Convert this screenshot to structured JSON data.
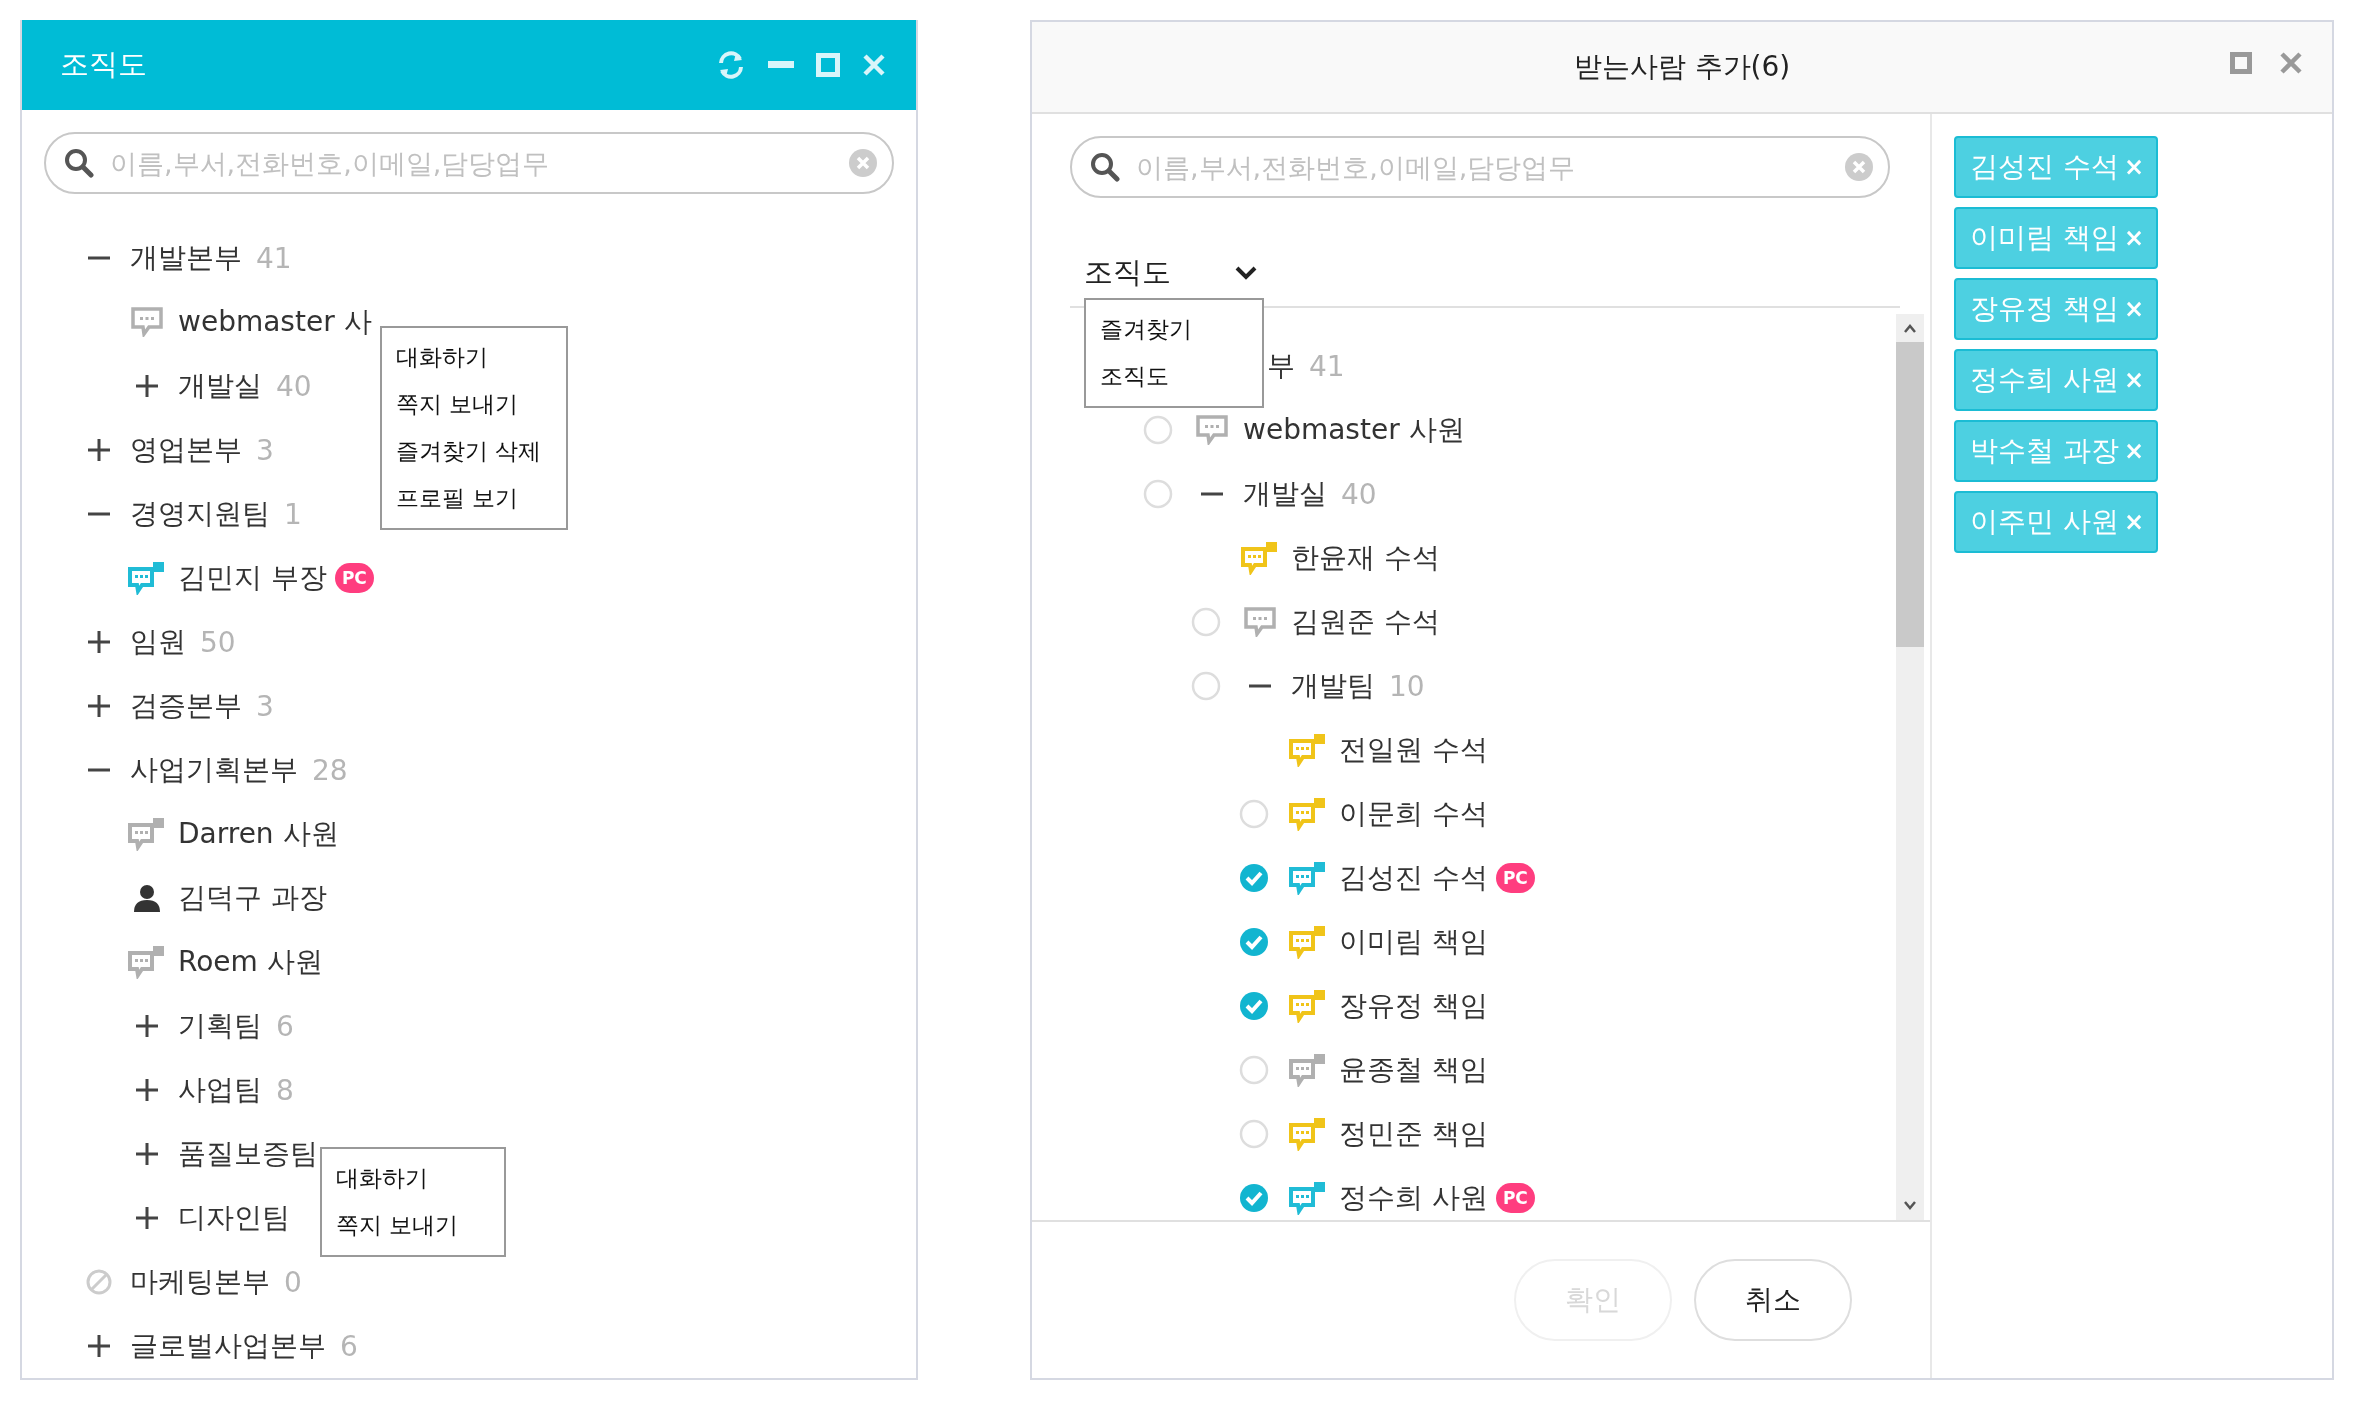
{
  "org_window": {
    "title": "조직도",
    "search": {
      "placeholder": "이름,부서,전화번호,이메일,담당업무"
    },
    "tree": [
      {
        "kind": "group",
        "name": "개발본부",
        "count": "41",
        "expanded": true,
        "children": [
          {
            "kind": "messenger",
            "name": "webmaster 사",
            "color": "#b0b0b0"
          },
          {
            "kind": "group",
            "name": "개발실",
            "count": "40",
            "expanded": false
          }
        ]
      },
      {
        "kind": "group",
        "name": "영업본부",
        "count": "3",
        "expanded": false
      },
      {
        "kind": "group",
        "name": "경영지원팀",
        "count": "1",
        "expanded": true,
        "children": [
          {
            "kind": "mobile",
            "name": "김민지 부장",
            "color": "#20bcd6",
            "badge": "PC"
          }
        ]
      },
      {
        "kind": "group",
        "name": "임원",
        "count": "50",
        "expanded": false
      },
      {
        "kind": "group",
        "name": "검증본부",
        "count": "3",
        "expanded": false
      },
      {
        "kind": "group",
        "name": "사업기획본부",
        "count": "28",
        "expanded": true,
        "children": [
          {
            "kind": "mobile",
            "name": "Darren 사원",
            "color": "#b0b0b0"
          },
          {
            "kind": "profile",
            "name": "김덕구 과장"
          },
          {
            "kind": "mobile",
            "name": "Roem 사원",
            "color": "#b0b0b0"
          },
          {
            "kind": "group",
            "name": "기획팀",
            "count": "6",
            "expanded": false
          },
          {
            "kind": "group",
            "name": "사업팀",
            "count": "8",
            "expanded": false
          },
          {
            "kind": "group",
            "name": "품질보증팀",
            "expanded": false
          },
          {
            "kind": "group",
            "name": "디자인팀",
            "expanded": false
          }
        ]
      },
      {
        "kind": "empty-group",
        "name": "마케팅본부",
        "count": "0"
      },
      {
        "kind": "group",
        "name": "글로벌사업본부",
        "count": "6",
        "expanded": false
      }
    ],
    "context_menus": [
      {
        "items": [
          "대화하기",
          "쪽지 보내기",
          "즐겨찾기 삭제",
          "프로필 보기"
        ]
      },
      {
        "items": [
          "대화하기",
          "쪽지 보내기"
        ]
      }
    ]
  },
  "recipient_dialog": {
    "title": "받는사람 추가(6)",
    "search": {
      "placeholder": "이름,부서,전화번호,이메일,담당업무"
    },
    "view_select": {
      "value": "조직도",
      "options": [
        "즐겨찾기",
        "조직도"
      ]
    },
    "tree": [
      {
        "kind": "covered-group",
        "name": "부",
        "count": "41",
        "children": [
          {
            "kind": "messenger",
            "name": "webmaster 사원",
            "color": "#b0b0b0",
            "checked": false
          },
          {
            "kind": "group",
            "name": "개발실",
            "count": "40",
            "expanded": true,
            "checked": false,
            "children": [
              {
                "kind": "mobile",
                "name": "한윤재 수석",
                "color": "#f0c419"
              },
              {
                "kind": "messenger",
                "name": "김원준 수석",
                "color": "#b0b0b0",
                "checked": false
              },
              {
                "kind": "group",
                "name": "개발팀",
                "count": "10",
                "expanded": true,
                "checked": false,
                "children": [
                  {
                    "kind": "mobile",
                    "name": "전일원 수석",
                    "color": "#f0c419"
                  },
                  {
                    "kind": "mobile",
                    "name": "이문희 수석",
                    "color": "#f0c419",
                    "checked": false
                  },
                  {
                    "kind": "mobile",
                    "name": "김성진 수석",
                    "color": "#20bcd6",
                    "checked": true,
                    "badge": "PC"
                  },
                  {
                    "kind": "mobile",
                    "name": "이미림 책임",
                    "color": "#f0c419",
                    "checked": true
                  },
                  {
                    "kind": "mobile",
                    "name": "장유정 책임",
                    "color": "#f0c419",
                    "checked": true
                  },
                  {
                    "kind": "mobile",
                    "name": "윤종철 책임",
                    "color": "#b0b0b0",
                    "checked": false
                  },
                  {
                    "kind": "mobile",
                    "name": "정민준 책임",
                    "color": "#f0c419",
                    "checked": false
                  },
                  {
                    "kind": "mobile",
                    "name": "정수희 사원",
                    "color": "#20bcd6",
                    "checked": true,
                    "badge": "PC"
                  }
                ]
              }
            ]
          }
        ]
      }
    ],
    "recipients": [
      {
        "label": "김성진 수석",
        "remove": "×"
      },
      {
        "label": "이미림 책임",
        "remove": "×"
      },
      {
        "label": "장유정 책임",
        "remove": "×"
      },
      {
        "label": "정수희 사원",
        "remove": "×"
      },
      {
        "label": "박수철 과장",
        "remove": "×"
      },
      {
        "label": "이주민 사원",
        "remove": "×"
      }
    ],
    "buttons": [
      {
        "label": "확인",
        "disabled": true
      },
      {
        "label": "취소",
        "disabled": false
      }
    ]
  }
}
